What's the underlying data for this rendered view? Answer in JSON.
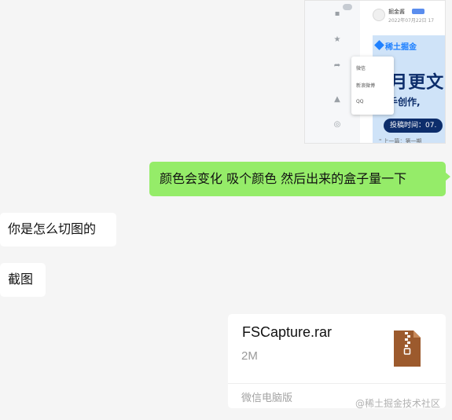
{
  "shared_image": {
    "author": "掘金酱",
    "post_date": "2022年07月22日 17",
    "brand": "稀土掘金",
    "headline": "8月更文",
    "subline": "精手创作,",
    "deadline": "投稿时间：07.",
    "quote": "\" 上一篇：第一期",
    "share_menu": [
      "微信",
      "新浪微博",
      "QQ"
    ],
    "accent_color": "#1e80ff",
    "banner_color": "#cfe3f8"
  },
  "messages": [
    {
      "sender": "me",
      "text": "颜色会变化 吸个颜色 然后出来的盒子量一下"
    },
    {
      "sender": "other",
      "text": "你是怎么切图的"
    },
    {
      "sender": "other",
      "text": "截图"
    }
  ],
  "file_message": {
    "file_name": "FSCapture.rar",
    "file_size": "2M",
    "source_label": "微信电脑版",
    "icon": "zip-archive-icon",
    "icon_color": "#9c5a2d"
  },
  "watermark": "@稀土掘金技术社区",
  "colors": {
    "self_bubble": "#95ec69",
    "other_bubble": "#ffffff",
    "background": "#f5f5f5"
  }
}
